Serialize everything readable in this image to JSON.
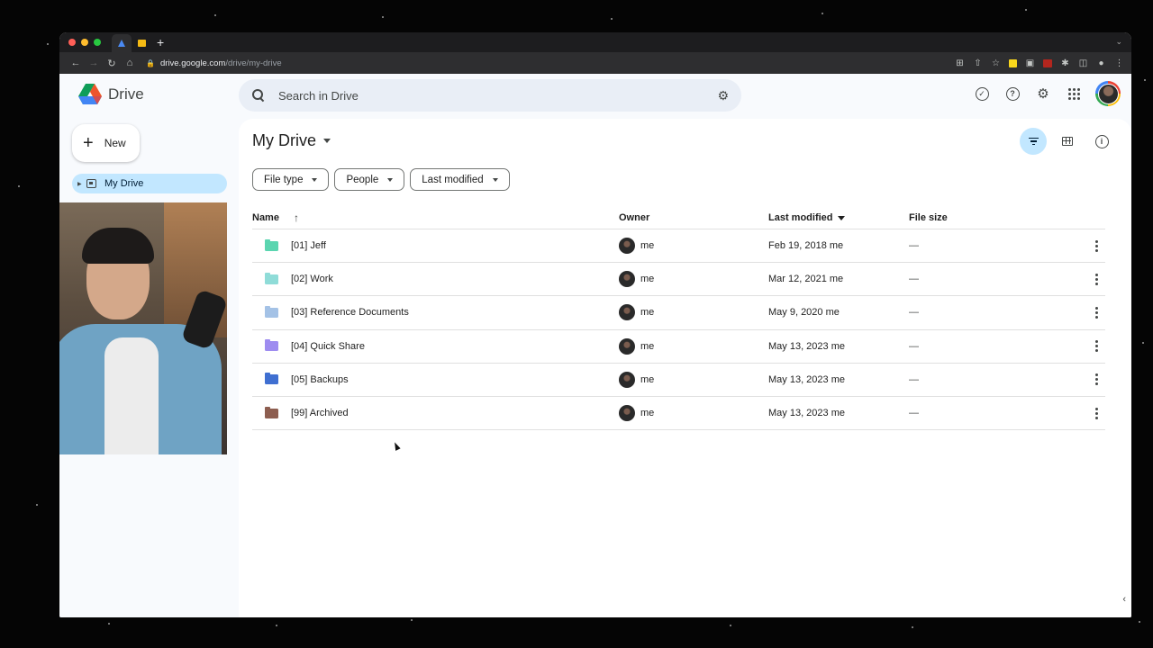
{
  "browser": {
    "url_host": "drive.google.com",
    "url_path": "/drive/my-drive",
    "new_tab": "+"
  },
  "app": {
    "name": "Drive",
    "search_placeholder": "Search in Drive"
  },
  "sidebar": {
    "new_label": "New",
    "items": [
      {
        "label": "My Drive",
        "active": true
      }
    ]
  },
  "main": {
    "title": "My Drive",
    "filters": [
      "File type",
      "People",
      "Last modified"
    ],
    "columns": {
      "name": "Name",
      "owner": "Owner",
      "last_modified": "Last modified",
      "file_size": "File size"
    },
    "rows": [
      {
        "name": "[01] Jeff",
        "owner": "me",
        "modified": "Feb 19, 2018 me",
        "size": "—",
        "folder_color": "#5bd5b0"
      },
      {
        "name": "[02] Work",
        "owner": "me",
        "modified": "Mar 12, 2021 me",
        "size": "—",
        "folder_color": "#8fdcd8"
      },
      {
        "name": "[03] Reference Documents",
        "owner": "me",
        "modified": "May 9, 2020 me",
        "size": "—",
        "folder_color": "#a4c2e6"
      },
      {
        "name": "[04] Quick Share",
        "owner": "me",
        "modified": "May 13, 2023 me",
        "size": "—",
        "folder_color": "#9e8cf0"
      },
      {
        "name": "[05] Backups",
        "owner": "me",
        "modified": "May 13, 2023 me",
        "size": "—",
        "folder_color": "#3f6fd1"
      },
      {
        "name": "[99] Archived",
        "owner": "me",
        "modified": "May 13, 2023 me",
        "size": "—",
        "folder_color": "#8d5e50"
      }
    ]
  },
  "colors": {
    "accent": "#c2e7ff",
    "search_bg": "#e9eef6",
    "app_bg": "#f8fafd"
  }
}
